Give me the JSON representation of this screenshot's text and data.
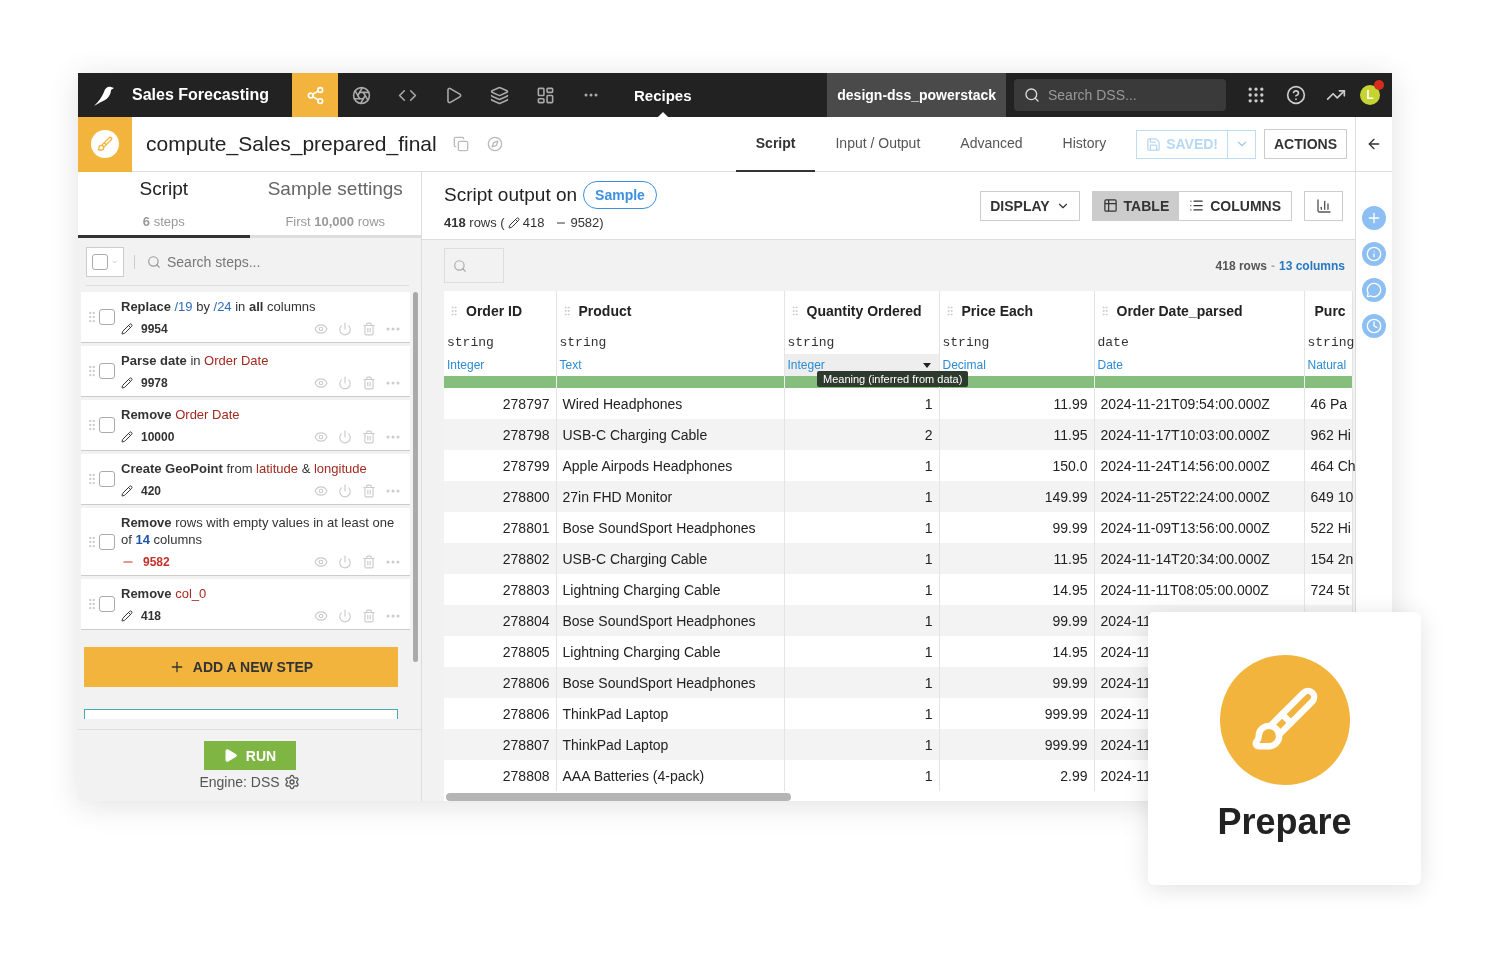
{
  "topbar": {
    "project": "Sales Forecasting",
    "nav": [
      {
        "kind": "flow",
        "selected": true
      },
      {
        "kind": "lab",
        "selected": false
      },
      {
        "kind": "code",
        "selected": false
      },
      {
        "kind": "run",
        "selected": false
      },
      {
        "kind": "datasets",
        "selected": false
      },
      {
        "kind": "dashboards",
        "selected": false
      },
      {
        "kind": "more",
        "selected": false
      }
    ],
    "section": "Recipes",
    "instance": "design-dss_powerstack",
    "search_placeholder": "Search DSS...",
    "avatar": "L",
    "notification": true
  },
  "recipe": {
    "name": "compute_Sales_prepared_final",
    "tabs": [
      {
        "label": "Script",
        "selected": true
      },
      {
        "label": "Input / Output",
        "selected": false
      },
      {
        "label": "Advanced",
        "selected": false
      },
      {
        "label": "History",
        "selected": false
      }
    ],
    "save_button": {
      "label": "SAVED!",
      "disabled": true
    },
    "actions": "ACTIONS"
  },
  "left": {
    "tabs": [
      {
        "label": "Script",
        "sub": "**6** steps",
        "selected": true
      },
      {
        "label": "Sample settings",
        "sub": "First **10,000** rows",
        "selected": false
      }
    ],
    "select_all": {
      "checked": false
    },
    "search_placeholder": "Search steps...",
    "steps": [
      {
        "checked": false,
        "removed": false,
        "count": "9954",
        "description": [
          {
            "kind": "op",
            "text": "Replace "
          },
          {
            "kind": "val",
            "text": "/19"
          },
          {
            "kind": "text",
            "text": " by "
          },
          {
            "kind": "val",
            "text": "/24"
          },
          {
            "kind": "text",
            "text": " in "
          },
          {
            "kind": "op",
            "text": "all"
          },
          {
            "kind": "text",
            "text": " columns"
          }
        ]
      },
      {
        "checked": false,
        "removed": false,
        "count": "9978",
        "description": [
          {
            "kind": "op",
            "text": "Parse date"
          },
          {
            "kind": "text",
            "text": " in "
          },
          {
            "kind": "col",
            "text": "Order Date"
          }
        ]
      },
      {
        "checked": false,
        "removed": false,
        "count": "10000",
        "description": [
          {
            "kind": "op",
            "text": "Remove "
          },
          {
            "kind": "col",
            "text": "Order Date"
          }
        ]
      },
      {
        "checked": false,
        "removed": false,
        "count": "420",
        "description": [
          {
            "kind": "op",
            "text": "Create GeoPoint"
          },
          {
            "kind": "text",
            "text": " from "
          },
          {
            "kind": "col",
            "text": "latitude"
          },
          {
            "kind": "text",
            "text": " & "
          },
          {
            "kind": "col",
            "text": "longitude"
          }
        ]
      },
      {
        "checked": false,
        "removed": true,
        "count": "9582",
        "description": [
          {
            "kind": "op",
            "text": "Remove"
          },
          {
            "kind": "text",
            "text": " rows with empty values in at least one of "
          },
          {
            "kind": "num",
            "text": "14"
          },
          {
            "kind": "text",
            "text": " columns"
          }
        ]
      },
      {
        "checked": false,
        "removed": false,
        "count": "418",
        "description": [
          {
            "kind": "op",
            "text": "Remove "
          },
          {
            "kind": "col",
            "text": "col_0"
          }
        ]
      }
    ],
    "add_step": "ADD A NEW STEP",
    "run": "RUN",
    "engine": "Engine: DSS"
  },
  "main": {
    "title": "Script output on",
    "sample": "Sample",
    "stats": {
      "rows": "**418** rows (",
      "edited": "418",
      "removed": "9582)"
    },
    "display": "DISPLAY",
    "views": [
      {
        "kind": "table",
        "label": "TABLE",
        "selected": true
      },
      {
        "kind": "columns",
        "label": "COLUMNS",
        "selected": false
      }
    ],
    "row_count": "418 rows",
    "separator": "-",
    "column_count": "13 columns",
    "columns": [
      {
        "name": "Order ID",
        "type": "string",
        "meaning": "Integer",
        "kind": "numeric",
        "hovered": false
      },
      {
        "name": "Product",
        "type": "string",
        "meaning": "Text",
        "kind": "text",
        "hovered": false
      },
      {
        "name": "Quantity Ordered",
        "type": "string",
        "meaning": "Integer",
        "kind": "numeric",
        "hovered": true
      },
      {
        "name": "Price Each",
        "type": "string",
        "meaning": "Decimal",
        "kind": "numeric",
        "hovered": false
      },
      {
        "name": "Order Date_parsed",
        "type": "date",
        "meaning": "Date",
        "kind": "text",
        "hovered": false
      },
      {
        "name": "Purc",
        "type": "string",
        "meaning": "Natural",
        "kind": "text",
        "hovered": false
      }
    ],
    "tooltip": "Meaning (inferred from data)",
    "rows": [
      [
        "278797",
        "Wired Headphones",
        "1",
        "11.99",
        "2024-11-21T09:54:00.000Z",
        "46 Pa"
      ],
      [
        "278798",
        "USB-C Charging Cable",
        "2",
        "11.95",
        "2024-11-17T10:03:00.000Z",
        "962 Hi"
      ],
      [
        "278799",
        "Apple Airpods Headphones",
        "1",
        "150.0",
        "2024-11-24T14:56:00.000Z",
        "464 Ch"
      ],
      [
        "278800",
        "27in FHD Monitor",
        "1",
        "149.99",
        "2024-11-25T22:24:00.000Z",
        "649 10"
      ],
      [
        "278801",
        "Bose SoundSport Headphones",
        "1",
        "99.99",
        "2024-11-09T13:56:00.000Z",
        "522 Hi"
      ],
      [
        "278802",
        "USB-C Charging Cable",
        "1",
        "11.95",
        "2024-11-14T20:34:00.000Z",
        "154 2n"
      ],
      [
        "278803",
        "Lightning Charging Cable",
        "1",
        "14.95",
        "2024-11-11T08:05:00.000Z",
        "724 5t"
      ],
      [
        "278804",
        "Bose SoundSport Headphones",
        "1",
        "99.99",
        "2024-11"
      ],
      [
        "278805",
        "Lightning Charging Cable",
        "1",
        "14.95",
        "2024-11"
      ],
      [
        "278806",
        "Bose SoundSport Headphones",
        "1",
        "99.99",
        "2024-11"
      ],
      [
        "278806",
        "ThinkPad Laptop",
        "1",
        "999.99",
        "2024-11"
      ],
      [
        "278807",
        "ThinkPad Laptop",
        "1",
        "999.99",
        "2024-11"
      ],
      [
        "278808",
        "AAA Batteries (4-pack)",
        "1",
        "2.99",
        "2024-11"
      ]
    ]
  },
  "badge": {
    "label": "Prepare"
  }
}
